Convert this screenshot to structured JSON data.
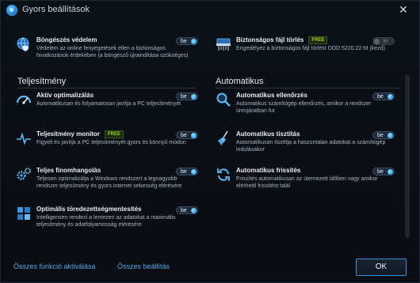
{
  "window": {
    "title": "Gyors beállítások",
    "close_glyph": "✕"
  },
  "top_items": [
    {
      "name": "Böngészés védelem",
      "desc": "Védelem az online fenyegetések ellen a biztonságos hivatkozások érdekében (a böngésző újraindítása szükséges)",
      "badge": "",
      "toggle": "be"
    },
    {
      "name": "Biztonságos fájl törlés",
      "desc": "Engedélyez a biztonságos fájl törlést DOD 5220.22-M (kezd)",
      "badge": "FREE",
      "toggle": "ki"
    }
  ],
  "sections": {
    "left_title": "Teljesítmény",
    "right_title": "Automatikus"
  },
  "left_items": [
    {
      "name": "Aktív optimalizálás",
      "desc": "Automatikusan és folyamatosan javítja a PC teljesítményét",
      "badge": "",
      "toggle": "be"
    },
    {
      "name": "Teljesítmény monitor",
      "desc": "Figyeli és javítja a PC teljesítményét gyors és könnyű módon",
      "badge": "FREE",
      "toggle": "be"
    },
    {
      "name": "Teljes finomhangolás",
      "desc": "Teljesen optimalizálja a Windows rendszert a legnagyobb rendszer teljesítmény és gyors internet sebesség elérésére",
      "badge": "",
      "toggle": "be"
    },
    {
      "name": "Optimális töredezettségmentesítés",
      "desc": "Intelligensen rendezi a lemezen az adatokat a maximális teljesítmény és adatfolyamosság elérésére",
      "badge": "",
      "toggle": "be"
    }
  ],
  "right_items": [
    {
      "name": "Automatikus ellenőrzés",
      "desc": "Automatikus számítógép ellenőrzés, amikor a rendszer üresjáratban fut",
      "badge": "",
      "toggle": "be"
    },
    {
      "name": "Automatikus tisztítás",
      "desc": "Automatikusan tisztítja a haszontalan adatokat a számítógép indulásakor",
      "badge": "",
      "toggle": "be"
    },
    {
      "name": "Automatikus frissítés",
      "desc": "Frissítés automatikusan az ütemezett időben vagy amikor elérhető frissítést talál",
      "badge": "",
      "toggle": "be"
    }
  ],
  "footer": {
    "activate_all": "Összes funkció aktiválása",
    "all_settings": "Összes beállítás",
    "ok": "OK"
  },
  "colors": {
    "accent": "#1e8fe6",
    "link": "#4fa8e8",
    "free_badge": "#9fd62a"
  },
  "icons": {
    "top": [
      "globe-shield-icon",
      "shredder-icon"
    ],
    "left": [
      "speedometer-icon",
      "pulse-icon",
      "gears-icon",
      "windows-tiles-icon"
    ],
    "right": [
      "magnifier-icon",
      "broom-icon",
      "refresh-icon"
    ]
  }
}
